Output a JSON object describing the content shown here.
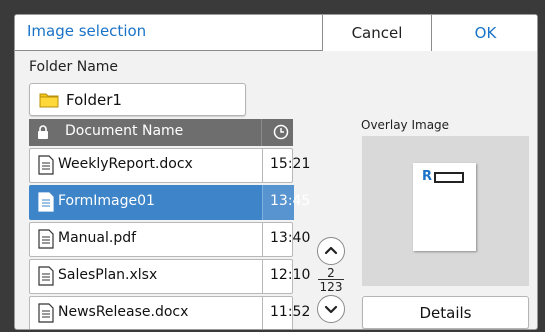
{
  "dialog": {
    "title": "Image selection",
    "cancel_label": "Cancel",
    "ok_label": "OK"
  },
  "folder": {
    "label": "Folder Name",
    "name": "Folder1"
  },
  "table": {
    "col_name": "Document Name",
    "rows": [
      {
        "name": "WeeklyReport.docx",
        "time": "15:21"
      },
      {
        "name": "FormImage01",
        "time": "13:45",
        "selected": true
      },
      {
        "name": "Manual.pdf",
        "time": "13:40"
      },
      {
        "name": "SalesPlan.xlsx",
        "time": "12:10"
      },
      {
        "name": "NewsRelease.docx",
        "time": "11:52"
      }
    ]
  },
  "pager": {
    "current": "2",
    "total": "123"
  },
  "overlay": {
    "label": "Overlay Image",
    "details_label": "Details"
  },
  "colors": {
    "accent": "#1a73c7",
    "selected_row": "#3d84c8",
    "header_bg": "#6e6e6e"
  },
  "icons": {
    "folder": "folder-icon",
    "lock": "lock-icon",
    "clock": "clock-icon",
    "document": "document-icon",
    "up": "chevron-up-icon",
    "down": "chevron-down-icon"
  }
}
